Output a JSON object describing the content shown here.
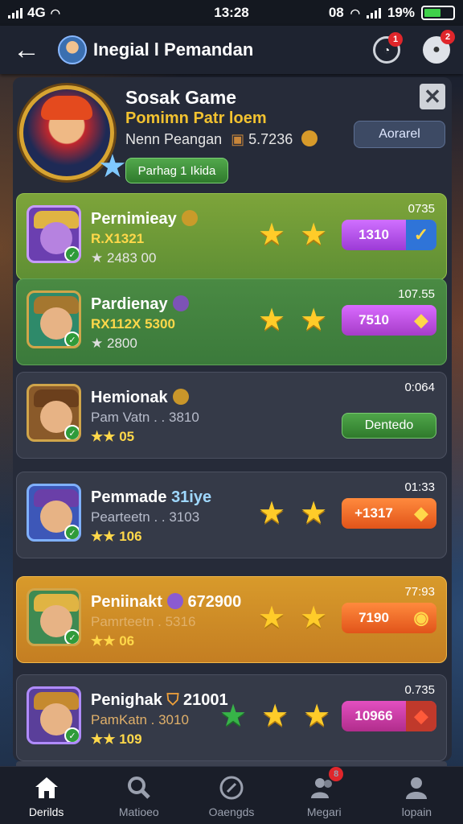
{
  "status": {
    "time": "13:28",
    "carrier": "4G",
    "right_text": "08",
    "battery": "19%"
  },
  "appbar": {
    "title": "Inegial l Pemandan",
    "badge_a": "1",
    "badge_b": "2"
  },
  "profile": {
    "name": "Sosak Game",
    "subtitle": "Pomimn Patr loem",
    "line": "Nenn Peangan",
    "coins": "5.7236",
    "pill": "Parhag 1 Ikida",
    "arrange": "Aorarel"
  },
  "rows": [
    {
      "name": "Pernimieay",
      "sub": "R.X1321",
      "stat": "2483 00",
      "time": "0735",
      "action": "1310",
      "stars": 2
    },
    {
      "name": "Pardienay",
      "sub": "RX112X 5300",
      "stat": "2800",
      "time": "107.55",
      "action": "7510",
      "stars": 2
    },
    {
      "name": "Hemionak",
      "sub": "Pam Vatn . . 3810",
      "stat": "05",
      "time": "0:064",
      "action": "Dentedo",
      "stars": 0
    },
    {
      "name": "Pemmade",
      "name_extra": "31iye",
      "sub": "Pearteetn . . 3103",
      "stat": "106",
      "time": "01:33",
      "action": "+1317",
      "stars": 2
    },
    {
      "name": "Peniinakt",
      "name_extra": "672900",
      "sub": "Pamrteetn . 5316",
      "stat": "06",
      "time": "77:93",
      "action": "7190",
      "stars": 2
    },
    {
      "name": "Penighak",
      "name_extra": "21001",
      "sub": "PamKatn . 3010",
      "stat": "109",
      "time": "0.735",
      "action": "10966",
      "stars": 3
    }
  ],
  "nav": [
    {
      "label": "Derilds",
      "icon": "home-icon"
    },
    {
      "label": "Matioeo",
      "icon": "search-icon"
    },
    {
      "label": "Oaengds",
      "icon": "compass-icon"
    },
    {
      "label": "Megari",
      "icon": "friends-icon",
      "badge": "8"
    },
    {
      "label": "lopain",
      "icon": "profile-icon"
    }
  ],
  "colors": {
    "accent_gold": "#f2c230",
    "green": "#5f8f34",
    "orange": "#d89a2b"
  }
}
